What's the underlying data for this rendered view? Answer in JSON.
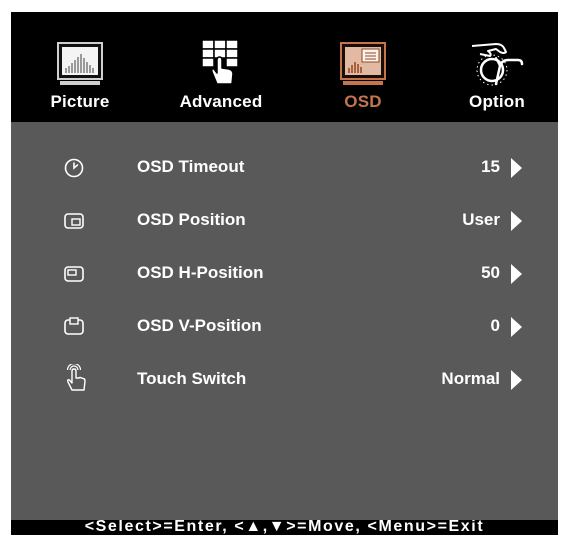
{
  "tabs": [
    {
      "label": "Picture",
      "icon": "picture-icon",
      "active": false
    },
    {
      "label": "Advanced",
      "icon": "advanced-icon",
      "active": false
    },
    {
      "label": "OSD",
      "icon": "osd-icon",
      "active": true
    },
    {
      "label": "Option",
      "icon": "option-icon",
      "active": false
    }
  ],
  "menu": {
    "items": [
      {
        "label": "OSD Timeout",
        "value": "15",
        "icon": "clock-icon"
      },
      {
        "label": "OSD Position",
        "value": "User",
        "icon": "osd-position-icon"
      },
      {
        "label": "OSD H-Position",
        "value": "50",
        "icon": "osd-h-position-icon"
      },
      {
        "label": "OSD V-Position",
        "value": "0",
        "icon": "osd-v-position-icon"
      },
      {
        "label": "Touch Switch",
        "value": "Normal",
        "icon": "touch-hand-icon"
      }
    ]
  },
  "footer": {
    "hint": "<Select>=Enter, <▲,▼>=Move, <Menu>=Exit"
  },
  "colors": {
    "active_tab": "#c4754f",
    "panel_bg": "#595959",
    "bar_bg": "#000000",
    "text": "#ffffff"
  }
}
